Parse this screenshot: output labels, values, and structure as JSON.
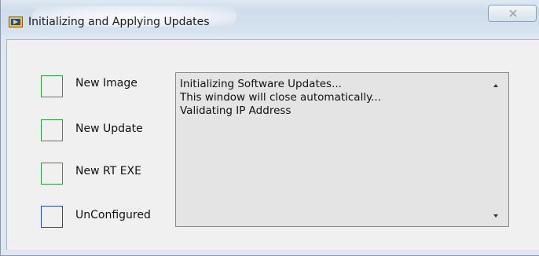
{
  "window": {
    "title": "Initializing and Applying Updates",
    "close_label": "",
    "icon": "labview-app-icon"
  },
  "indicators": [
    {
      "label": "New Image",
      "icon": "status-square-green",
      "color": "#2e9a3e"
    },
    {
      "label": "New Update",
      "icon": "status-square-green",
      "color": "#2e9a3e"
    },
    {
      "label": "New RT EXE",
      "icon": "status-square-green",
      "color": "#2e9a3e"
    },
    {
      "label": "UnConfigured",
      "icon": "status-square-blue",
      "color": "#2646b5"
    }
  ],
  "log": {
    "lines": [
      "Initializing Software Updates...",
      "This window will close automatically...",
      "Validating IP Address"
    ]
  }
}
